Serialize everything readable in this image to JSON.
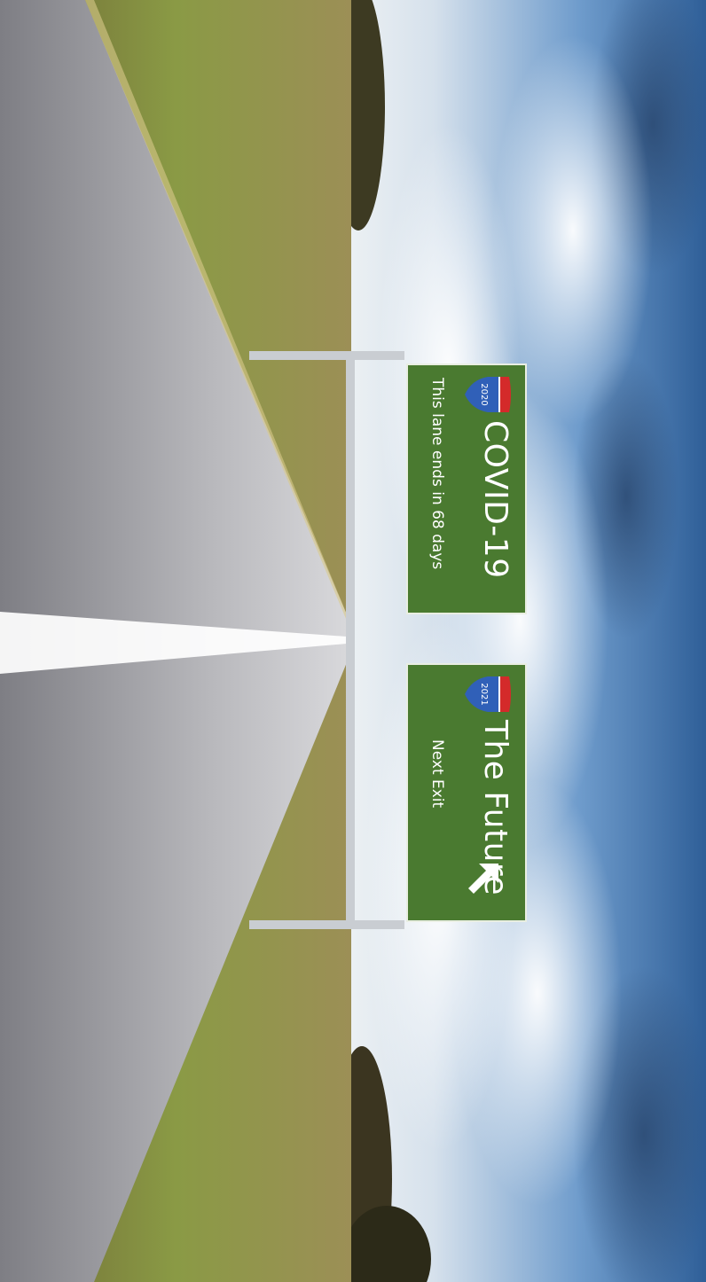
{
  "scene": {
    "colors": {
      "sky_top": "#3f6fa6",
      "sky_bottom": "#dfe7ee",
      "road": "#8f8f93",
      "grass": "#a89a55",
      "sign_green": "#4a7a30",
      "shield_red": "#d42a2a",
      "shield_blue": "#3060b8",
      "white": "#ffffff"
    },
    "icons": [
      "interstate-shield-icon",
      "up-left-arrow-icon"
    ]
  },
  "signs": [
    {
      "shield_text": "2020",
      "title": "COVID-19",
      "subtitle": "This lane ends in 68 days"
    },
    {
      "shield_text": "2021",
      "title": "The Future",
      "subtitle": "Next Exit"
    }
  ]
}
